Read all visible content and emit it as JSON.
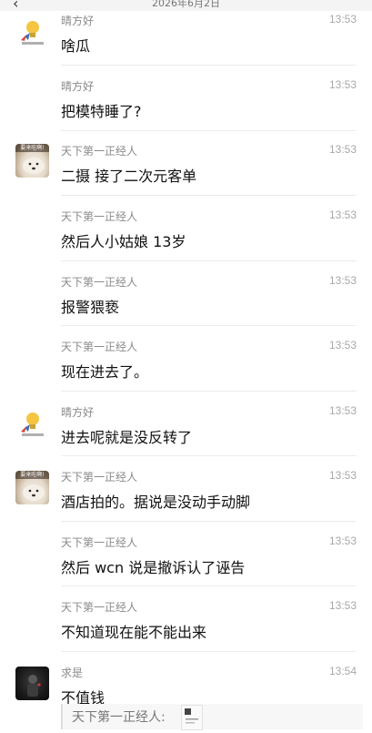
{
  "header": {
    "date": "2026年6月2日",
    "back_icon": "back-arrow-icon"
  },
  "messages": [
    {
      "sender": "晴方好",
      "time": "13:53",
      "text": "啥瓜",
      "avatar": "qing"
    },
    {
      "sender": "晴方好",
      "time": "13:53",
      "text": "把模特睡了?"
    },
    {
      "sender": "天下第一正经人",
      "time": "13:53",
      "text": "二摄 接了二次元客单",
      "avatar": "dog"
    },
    {
      "sender": "天下第一正经人",
      "time": "13:53",
      "text": "然后人小姑娘 13岁"
    },
    {
      "sender": "天下第一正经人",
      "time": "13:53",
      "text": "报警猥亵"
    },
    {
      "sender": "天下第一正经人",
      "time": "13:53",
      "text": "现在进去了。"
    },
    {
      "sender": "晴方好",
      "time": "13:53",
      "text": "进去呢就是没反转了",
      "avatar": "qing"
    },
    {
      "sender": "天下第一正经人",
      "time": "13:53",
      "text": "酒店拍的。据说是没动手动脚",
      "avatar": "dog"
    },
    {
      "sender": "天下第一正经人",
      "time": "13:53",
      "text": "然后 wcn 说是撤诉认了诬告"
    },
    {
      "sender": "天下第一正经人",
      "time": "13:53",
      "text": "不知道现在能不能出来"
    },
    {
      "sender": "求是",
      "time": "13:54",
      "text": "不值钱",
      "avatar": "qiu"
    }
  ],
  "quote": {
    "text": "天下第一正经人:"
  },
  "avatars": {
    "dog_caption": "要来吃啊!"
  }
}
